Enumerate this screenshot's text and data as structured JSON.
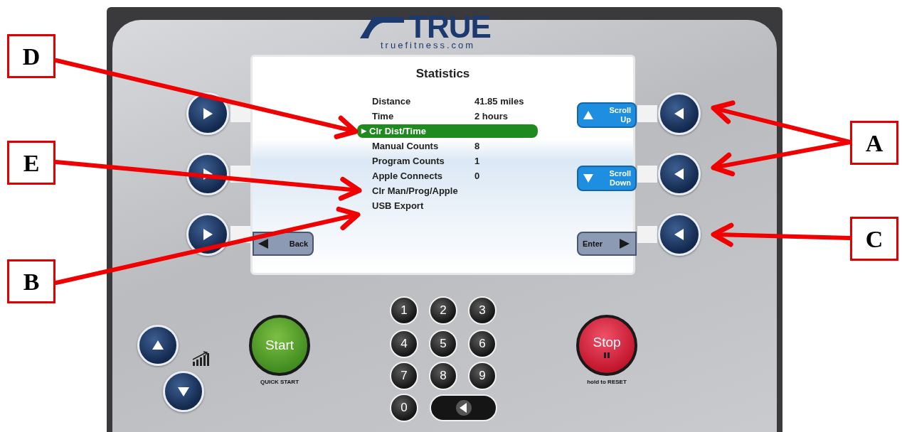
{
  "logo": {
    "brand": "TRUE",
    "site": "truefitness.com"
  },
  "screen": {
    "title": "Statistics",
    "rows": [
      {
        "label": "Distance",
        "value": "41.85 miles",
        "selected": false
      },
      {
        "label": "Time",
        "value": "2 hours",
        "selected": false
      },
      {
        "label": "Clr Dist/Time",
        "marker": "▶",
        "selected": true
      },
      {
        "label": "Manual Counts",
        "value": "8",
        "selected": false
      },
      {
        "label": "Program Counts",
        "value": "1",
        "selected": false
      },
      {
        "label": "Apple Connects",
        "value": "0",
        "selected": false
      },
      {
        "label": "Clr Man/Prog/Apple",
        "selected": false
      },
      {
        "label": "USB Export",
        "selected": false
      }
    ],
    "soft_keys": [
      {
        "kind": "up",
        "lines": [
          "Scroll",
          "Up"
        ]
      },
      {
        "kind": "down",
        "lines": [
          "Scroll",
          "Down"
        ]
      },
      {
        "kind": "back",
        "lines": [
          "Back"
        ]
      },
      {
        "kind": "enter",
        "lines": [
          "Enter"
        ]
      }
    ]
  },
  "keypad": [
    "1",
    "2",
    "3",
    "4",
    "5",
    "6",
    "7",
    "8",
    "9",
    "0"
  ],
  "start": {
    "label": "Start",
    "caption": "QUICK START"
  },
  "stop": {
    "label": "Stop",
    "caption": "hold to RESET"
  },
  "callouts": [
    {
      "letter": "D"
    },
    {
      "letter": "E"
    },
    {
      "letter": "B"
    },
    {
      "letter": "A"
    },
    {
      "letter": "C"
    }
  ]
}
